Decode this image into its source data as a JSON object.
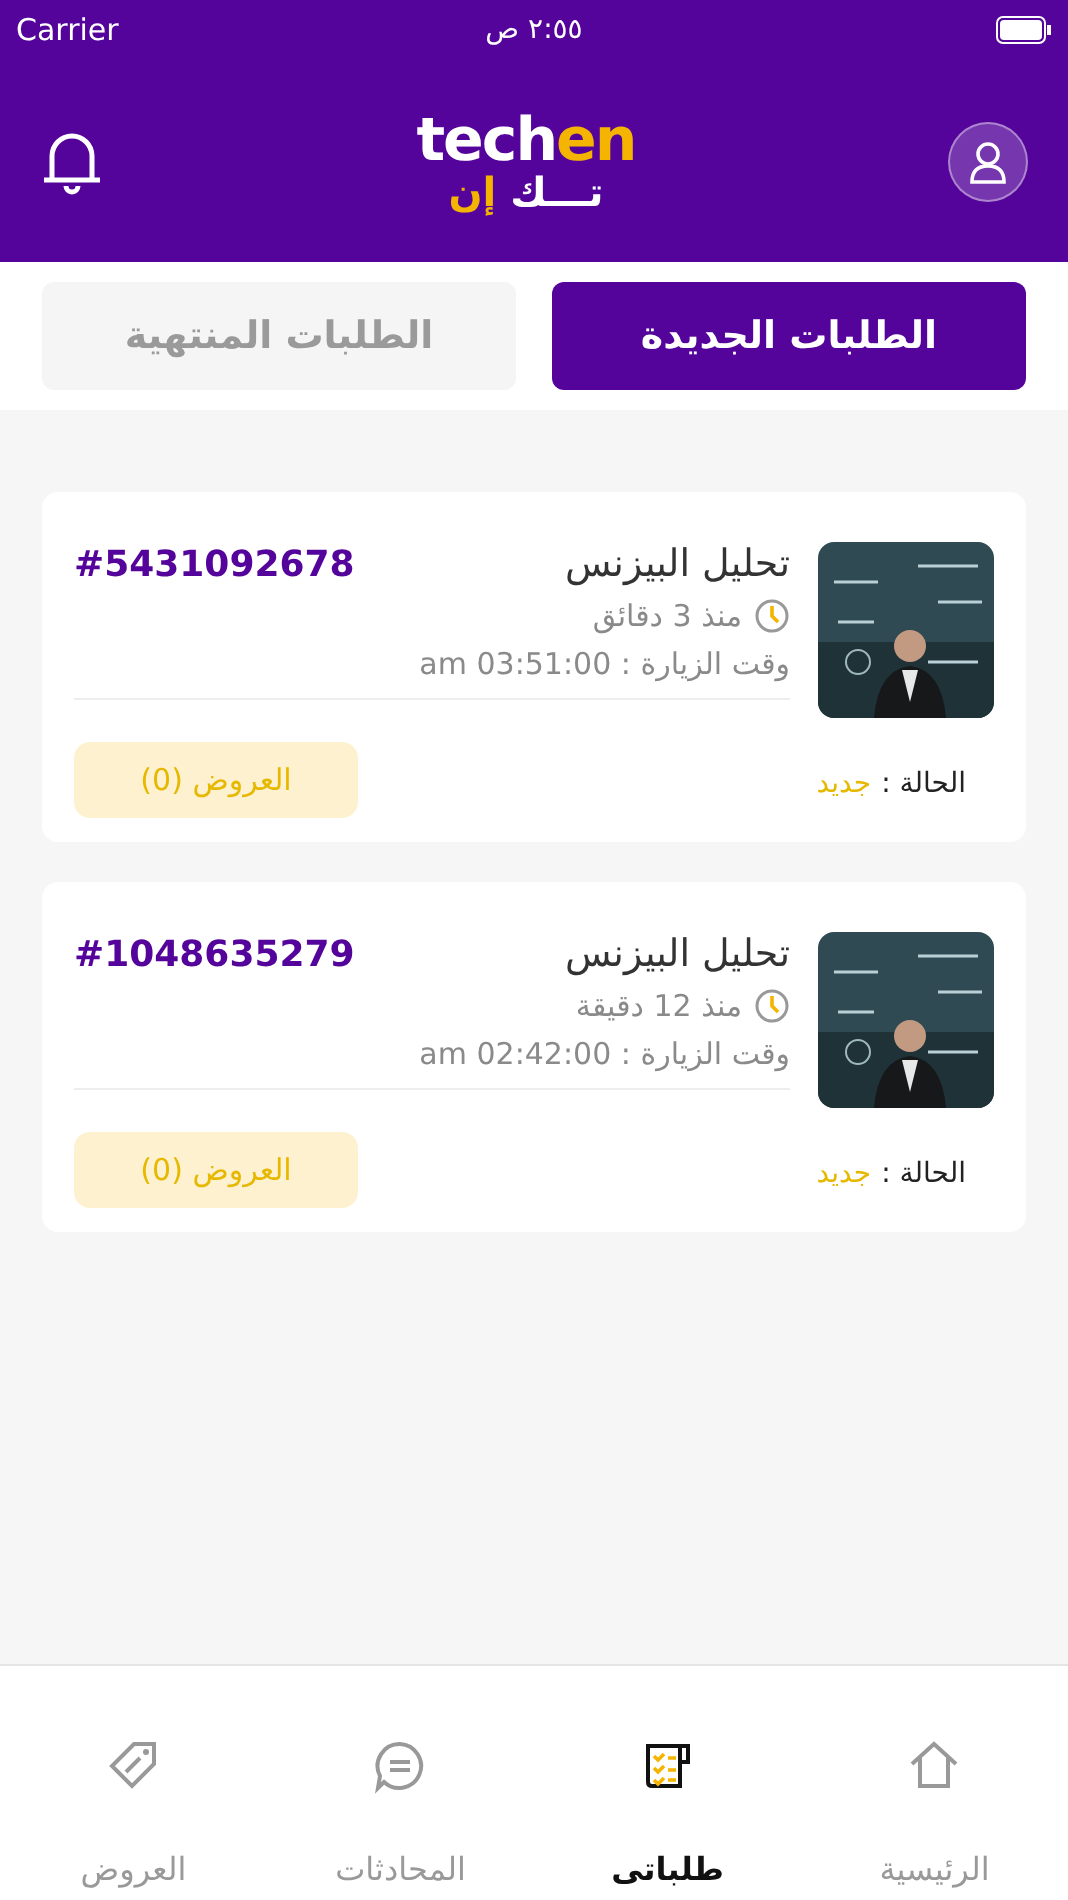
{
  "status_bar": {
    "carrier": "Carrier",
    "time": "٢:٥٥ ص"
  },
  "header": {
    "logo": {
      "latin_1": "tech",
      "latin_2": "en",
      "arabic_1": "تـــك",
      "arabic_2": "إن"
    }
  },
  "tabs": [
    {
      "label": "الطلبات الجديدة",
      "selected": true
    },
    {
      "label": "الطلبات المنتهية",
      "selected": false
    }
  ],
  "orders": [
    {
      "title": "تحليل البيزنس",
      "number": "#5431092678",
      "since": "منذ 3 دقائق",
      "visit_time": "وقت الزيارة : 03:51:00 am",
      "status_label": "الحالة :",
      "status": "جديد",
      "offers": "العروض (0)"
    },
    {
      "title": "تحليل البيزنس",
      "number": "#1048635279",
      "since": "منذ 12 دقيقة",
      "visit_time": "وقت الزيارة : 02:42:00 am",
      "status_label": "الحالة :",
      "status": "جديد",
      "offers": "العروض (0)"
    }
  ],
  "bottom_nav": [
    {
      "kind": "home",
      "label": "الرئيسية",
      "selected": false
    },
    {
      "kind": "orders",
      "label": "طلباتى",
      "selected": true
    },
    {
      "kind": "chats",
      "label": "المحادثات",
      "selected": false
    },
    {
      "kind": "offers",
      "label": "العروض",
      "selected": false
    }
  ]
}
